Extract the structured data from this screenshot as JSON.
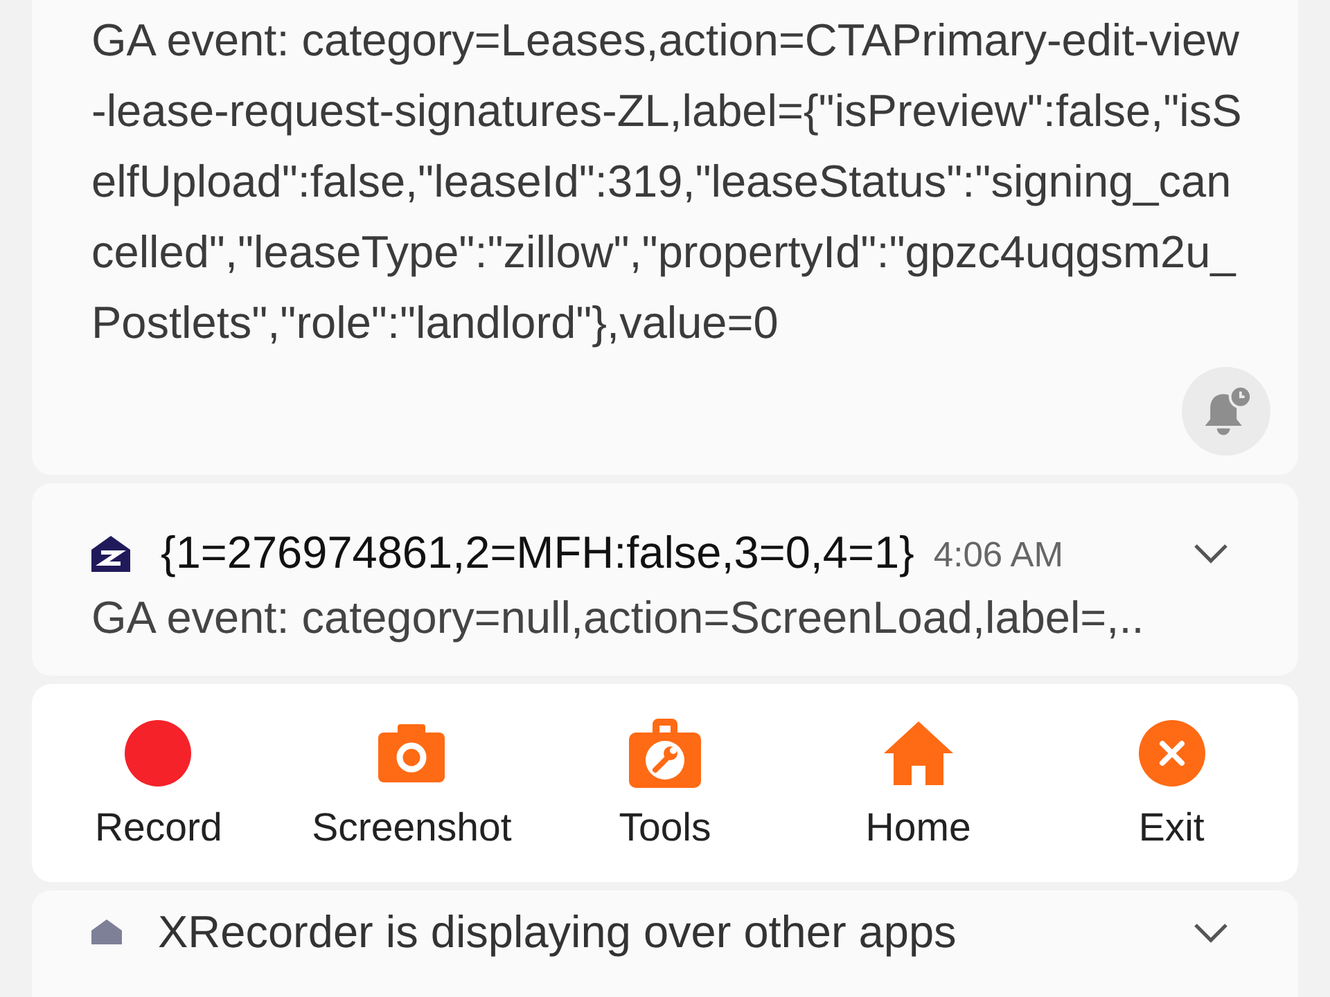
{
  "expanded_notification": {
    "body": "GA event: category=Leases,action=CTAPrimary-edit-view-lease-request-signatures-ZL,label={\"isPreview\":false,\"isSelfUpload\":false,\"leaseId\":319,\"leaseStatus\":\"signing_cancelled\",\"leaseType\":\"zillow\",\"propertyId\":\"gpzc4uqgsm2u_Postlets\",\"role\":\"landlord\"},value=0"
  },
  "notification": {
    "title": "{1=276974861,2=MFH:false,3=0,4=1}",
    "time": "4:06 AM",
    "body": "GA event: category=null,action=ScreenLoad,label=,.."
  },
  "recorder_toolbar": [
    {
      "kind": "record",
      "label": "Record"
    },
    {
      "kind": "screenshot",
      "label": "Screenshot"
    },
    {
      "kind": "tools",
      "label": "Tools"
    },
    {
      "kind": "home",
      "label": "Home"
    },
    {
      "kind": "exit",
      "label": "Exit"
    }
  ],
  "overlay_notification": {
    "title": "XRecorder is displaying over other apps"
  }
}
